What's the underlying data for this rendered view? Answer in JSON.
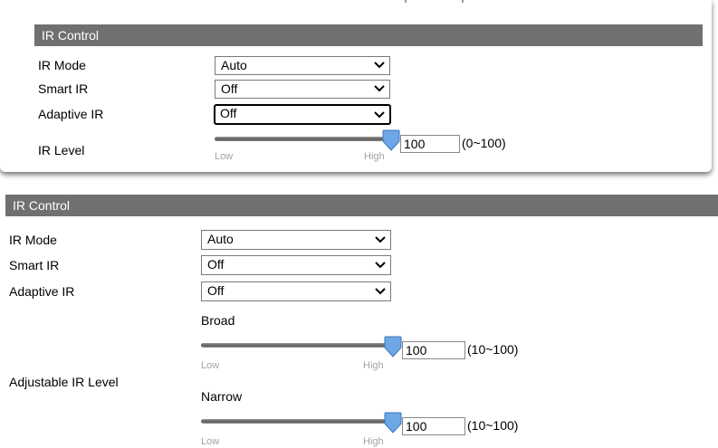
{
  "top": {
    "header": "IR Control",
    "ir_mode": {
      "label": "IR Mode",
      "value": "Auto"
    },
    "smart_ir": {
      "label": "Smart IR",
      "value": "Off"
    },
    "adaptive_ir": {
      "label": "Adaptive IR",
      "value": "Off"
    },
    "ir_level": {
      "label": "IR Level",
      "value": "100",
      "range": "(0~100)",
      "low": "Low",
      "high": "High",
      "level_percent": 100
    }
  },
  "bottom": {
    "header": "IR Control",
    "ir_mode": {
      "label": "IR Mode",
      "value": "Auto"
    },
    "smart_ir": {
      "label": "Smart IR",
      "value": "Off"
    },
    "adaptive_ir": {
      "label": "Adaptive IR",
      "value": "Off"
    },
    "adjustable_label": "Adjustable IR Level",
    "broad": {
      "label": "Broad",
      "value": "100",
      "range": "(10~100)",
      "low": "Low",
      "high": "High",
      "level_percent": 100
    },
    "narrow": {
      "label": "Narrow",
      "value": "100",
      "range": "(10~100)",
      "low": "Low",
      "high": "High",
      "level_percent": 100
    }
  },
  "icons": {
    "dropdown": "chevron-down-icon",
    "slider_thumb": "slider-thumb-icon"
  },
  "colors": {
    "header_bg": "#707070",
    "header_text": "#ffffff",
    "thumb": "#6ea7e6",
    "tick_text": "#a3a3a3"
  }
}
